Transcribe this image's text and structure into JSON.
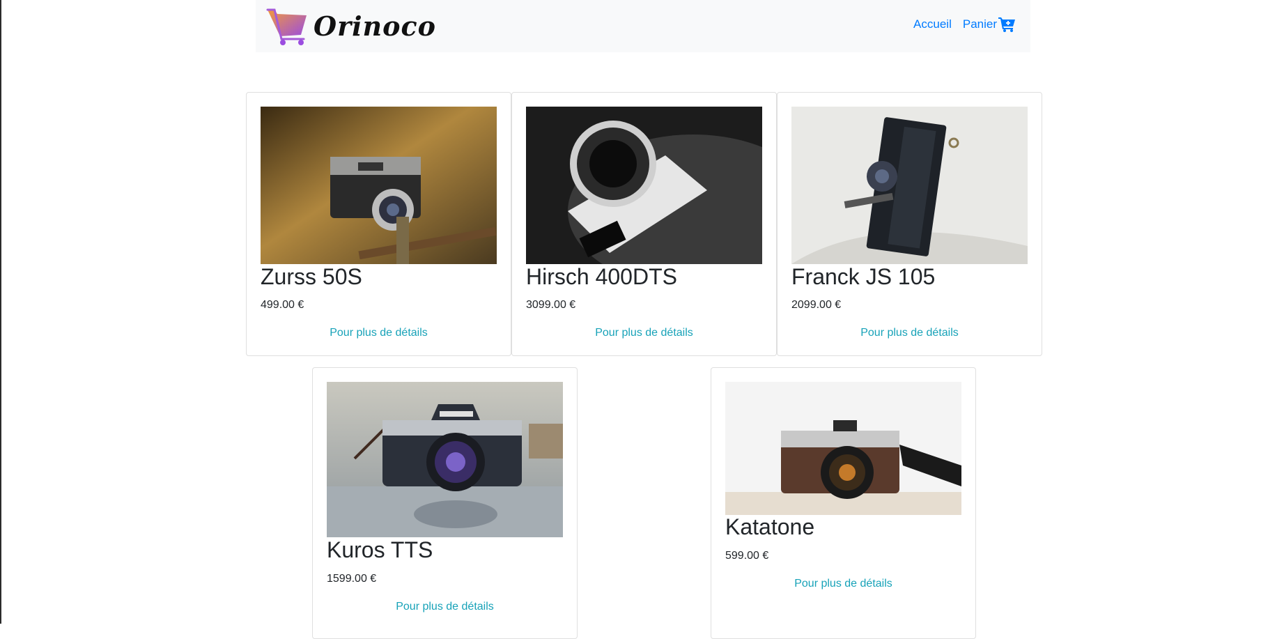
{
  "header": {
    "brand": "Orinoco",
    "nav": {
      "home": "Accueil",
      "cart": "Panier"
    }
  },
  "colors": {
    "nav_link": "#007bff",
    "detail_link": "#17a2b8",
    "navbar_bg": "#f8f9fa",
    "logo_gradient": [
      "#f29a3a",
      "#9b4de0"
    ]
  },
  "products": [
    {
      "name": "Zurss 50S",
      "price": "499.00 €",
      "link": "Pour plus de détails"
    },
    {
      "name": "Hirsch 400DTS",
      "price": "3099.00 €",
      "link": "Pour plus de détails"
    },
    {
      "name": "Franck JS 105",
      "price": "2099.00 €",
      "link": "Pour plus de détails"
    },
    {
      "name": "Kuros TTS",
      "price": "1599.00 €",
      "link": "Pour plus de détails"
    },
    {
      "name": "Katatone",
      "price": "599.00 €",
      "link": "Pour plus de détails"
    }
  ]
}
